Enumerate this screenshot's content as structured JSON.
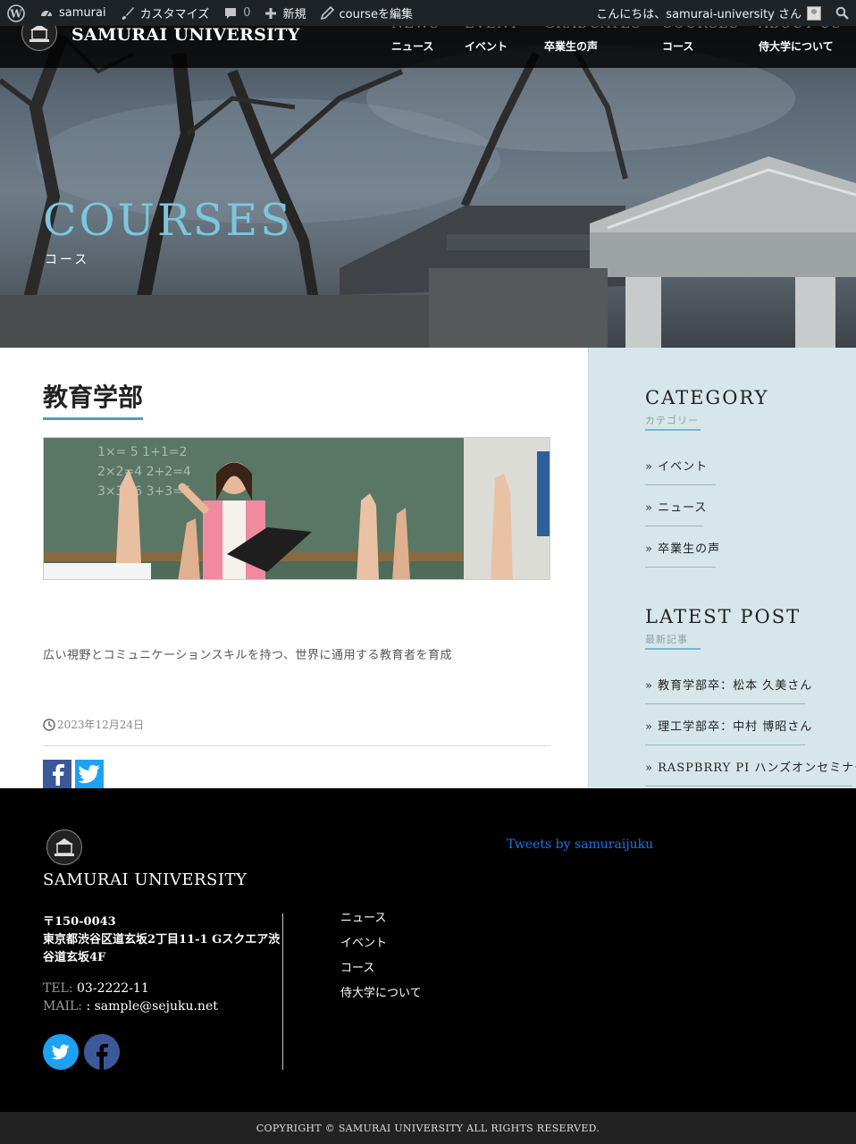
{
  "admin_bar": {
    "site_name": "samurai",
    "customize": "カスタマイズ",
    "comments_count": "0",
    "new": "新規",
    "edit": "courseを編集",
    "greeting": "こんにちは、samurai-university さん"
  },
  "header": {
    "site_title": "SAMURAI UNIVERSITY",
    "nav": [
      {
        "en": "NEWS",
        "ja": "ニュース"
      },
      {
        "en": "EVENT",
        "ja": "イベント"
      },
      {
        "en": "GRADUATES",
        "ja": "卒業生の声"
      },
      {
        "en": "COURSES",
        "ja": "コース"
      },
      {
        "en": "ABOUT US",
        "ja": "侍大学について"
      }
    ]
  },
  "hero": {
    "title": "COURSES",
    "subtitle": "コース"
  },
  "post": {
    "title": "教育学部",
    "description": "広い視野とコミュニケーションスキルを持つ、世界に通用する教育者を育成",
    "date": "2023年12月24日"
  },
  "sidebar": {
    "category_title": "CATEGORY",
    "category_sub": "カテゴリー",
    "categories": [
      "» イベント",
      "» ニュース",
      "» 卒業生の声"
    ],
    "latest_title": "LATEST POST",
    "latest_sub": "最新記事",
    "latest": [
      "» 教育学部卒：松本 久美さん",
      "» 理工学部卒：中村 博昭さん",
      "» RASPBRRY PI ハンズオンセミナー"
    ]
  },
  "footer": {
    "site_title": "SAMURAI UNIVERSITY",
    "postal": "〒150-0043",
    "address": "東京都渋谷区道玄坂2丁目11-1 Gスクエア渋谷道玄坂4F",
    "tel_label": "TEL:",
    "tel": " 03-2222-11",
    "mail_label": "MAIL:",
    "mail": " : sample@sejuku.net",
    "nav": [
      "ニュース",
      "イベント",
      "コース",
      "侍大学について"
    ],
    "tweets": "Tweets by samuraijuku",
    "copyright": "COPYRIGHT © SAMURAI UNIVERSITY ALL RIGHTS RESERVED."
  },
  "colors": {
    "accent": "#7cc7e0",
    "sidebar_bg": "#d7e6ea",
    "facebook": "#3b5998",
    "twitter": "#1da1f2"
  }
}
